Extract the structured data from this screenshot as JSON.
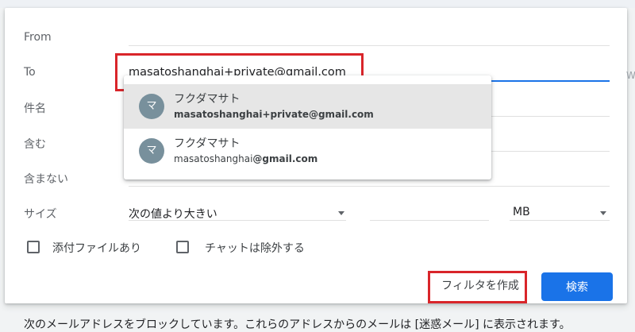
{
  "form": {
    "from_label": "From",
    "to_label": "To",
    "to_value": "masatoshanghai+private@gmail.com",
    "subject_label": "件名",
    "has_words_label": "含む",
    "not_words_label": "含まない",
    "size_label": "サイズ",
    "size_operator": "次の値より大きい",
    "size_unit": "MB",
    "has_attachment_label": "添付ファイルあり",
    "exclude_chats_label": "チャットは除外する",
    "create_filter_label": "フィルタを作成",
    "search_label": "検索"
  },
  "suggestions": [
    {
      "initial": "マ",
      "name": "フクダマサト",
      "email_local": "masatoshanghai+private",
      "email_domain": "@gmail.com",
      "selected": true
    },
    {
      "initial": "マ",
      "name": "フクダマサト",
      "email_local": "masatoshanghai",
      "email_domain": "@gmail.com",
      "selected": false
    }
  ],
  "background": {
    "partial_text": "次のメールアドレスをブロックしています。これらのアドレスからのメールは [迷惑メール] に表示されます。",
    "edge_mark": "W"
  },
  "colors": {
    "highlight": "#d9252a",
    "primary": "#1a73e8",
    "avatar": "#78909c"
  }
}
